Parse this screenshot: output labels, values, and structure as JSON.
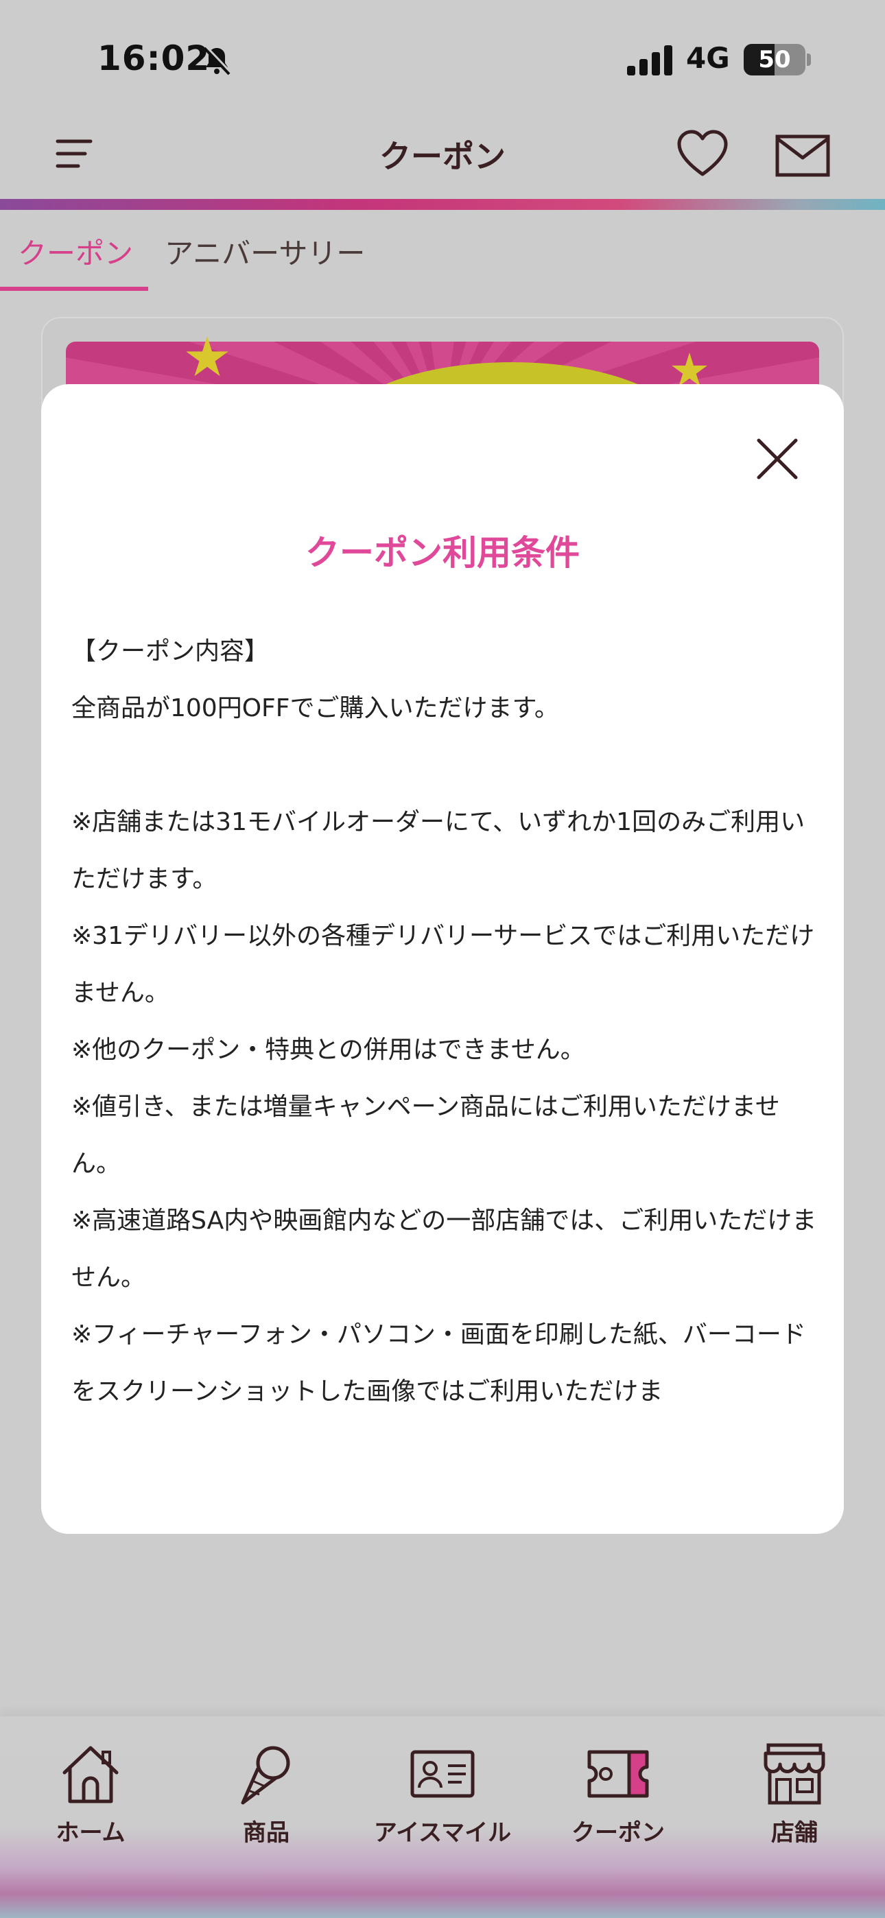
{
  "status_bar": {
    "time": "16:02",
    "network": "4G",
    "battery": "50",
    "battery_level_percent": 50
  },
  "header": {
    "title": "クーポン"
  },
  "tabs": [
    {
      "label": "クーポン",
      "active": true
    },
    {
      "label": "アニバーサリー",
      "active": false
    }
  ],
  "modal": {
    "title": "クーポン利用条件",
    "paragraphs": [
      "【クーポン内容】",
      "全商品が100円OFFでご購入いただけます。",
      "",
      "※店舗または31モバイルオーダーにて、いずれか1回のみご利用いただけます。",
      "※31デリバリー以外の各種デリバリーサービスではご利用いただけません。",
      "※他のクーポン・特典との併用はできません。",
      "※値引き、または増量キャンペーン商品にはご利用いただけません。",
      "※高速道路SA内や映画館内などの一部店舗では、ご利用いただけません。",
      "※フィーチャーフォン・パソコン・画面を印刷した紙、バーコードをスクリーンショットした画像ではご利用いただけま"
    ]
  },
  "bottom_nav": [
    {
      "label": "ホーム",
      "icon": "home-icon"
    },
    {
      "label": "商品",
      "icon": "ice-cream-icon"
    },
    {
      "label": "アイスマイル",
      "icon": "member-card-icon"
    },
    {
      "label": "クーポン",
      "icon": "coupon-ticket-icon"
    },
    {
      "label": "店舗",
      "icon": "store-icon"
    }
  ],
  "colors": {
    "accent_pink": "#e0489a",
    "tab_active": "#d6408a",
    "dark_brown": "#3a1f22",
    "overlay_gray": "#cccccc"
  }
}
